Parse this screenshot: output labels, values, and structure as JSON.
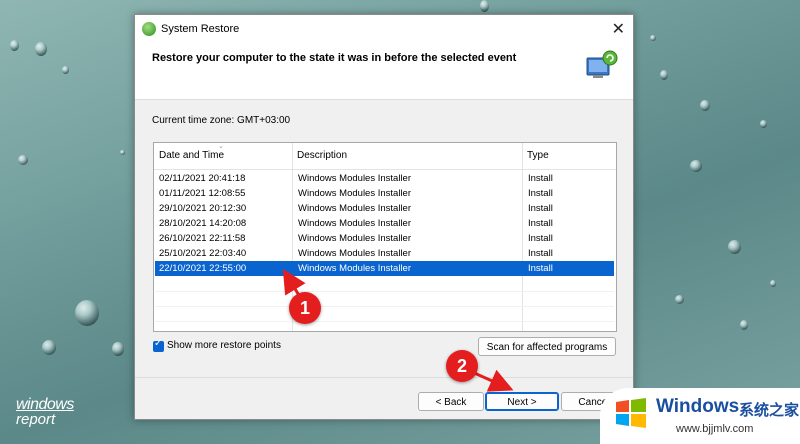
{
  "window": {
    "title": "System Restore",
    "heading": "Restore your computer to the state it was in before the selected event",
    "timezone": "Current time zone: GMT+03:00"
  },
  "table": {
    "headers": [
      "Date and Time",
      "Description",
      "Type"
    ],
    "rows": [
      {
        "date": "02/11/2021 20:41:18",
        "description": "Windows Modules Installer",
        "type": "Install"
      },
      {
        "date": "01/11/2021 12:08:55",
        "description": "Windows Modules Installer",
        "type": "Install"
      },
      {
        "date": "29/10/2021 20:12:30",
        "description": "Windows Modules Installer",
        "type": "Install"
      },
      {
        "date": "28/10/2021 14:20:08",
        "description": "Windows Modules Installer",
        "type": "Install"
      },
      {
        "date": "26/10/2021 22:11:58",
        "description": "Windows Modules Installer",
        "type": "Install"
      },
      {
        "date": "25/10/2021 22:03:40",
        "description": "Windows Modules Installer",
        "type": "Install"
      },
      {
        "date": "22/10/2021 22:55:00",
        "description": "Windows Modules Installer",
        "type": "Install"
      }
    ],
    "selected_index": 6
  },
  "controls": {
    "show_more_label": "Show more restore points",
    "show_more_checked": true,
    "scan_label": "Scan for affected programs",
    "back_label": "< Back",
    "next_label": "Next >",
    "cancel_label": "Cancel"
  },
  "annotations": {
    "badge1": "1",
    "badge2": "2",
    "color": "#e41e1e"
  },
  "watermarks": {
    "left_line1": "windows",
    "left_line2": "report",
    "brand": "Windows",
    "brand_cn": "系统之家",
    "url": "www.bjjmlv.com"
  },
  "colors": {
    "selection": "#0a64d0",
    "brand_blue": "#1a4fa0"
  }
}
